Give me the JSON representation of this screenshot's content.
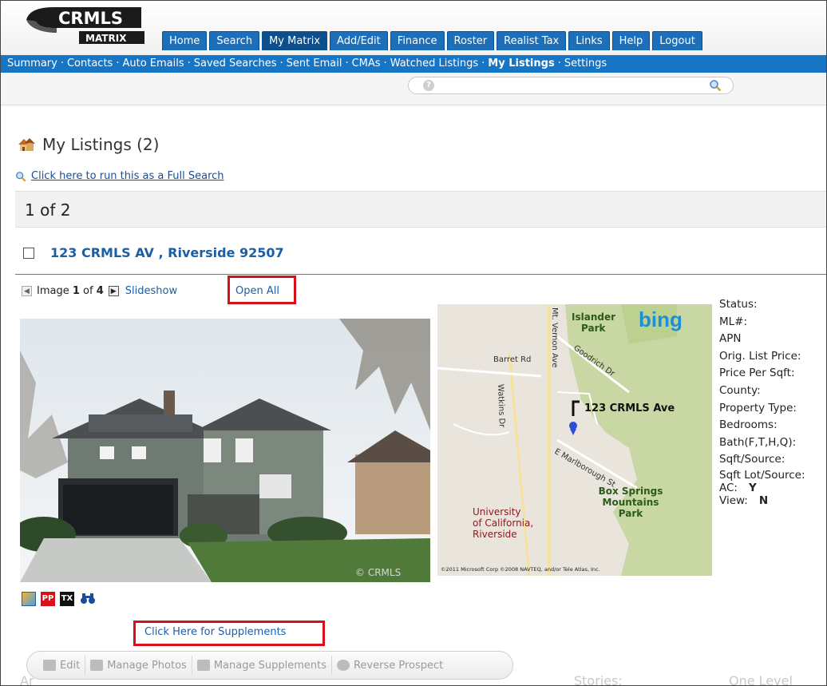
{
  "app": {
    "logo_top": "CRMLS",
    "logo_bottom": "MATRIX"
  },
  "tabs": [
    {
      "label": "Home"
    },
    {
      "label": "Search"
    },
    {
      "label": "My Matrix"
    },
    {
      "label": "Add/Edit"
    },
    {
      "label": "Finance"
    },
    {
      "label": "Roster"
    },
    {
      "label": "Realist Tax"
    },
    {
      "label": "Links"
    },
    {
      "label": "Help"
    },
    {
      "label": "Logout"
    }
  ],
  "subnav": [
    {
      "label": "Summary"
    },
    {
      "label": "Contacts"
    },
    {
      "label": "Auto Emails"
    },
    {
      "label": "Saved Searches"
    },
    {
      "label": "Sent Email"
    },
    {
      "label": "CMAs"
    },
    {
      "label": "Watched Listings"
    },
    {
      "label": "My Listings",
      "active": true
    },
    {
      "label": "Settings"
    }
  ],
  "separator": "·",
  "page": {
    "title": "My Listings (2)",
    "full_search_link": "Click here to run this as a Full Search",
    "counter": "1 of 2"
  },
  "listing": {
    "address": "123 CRMLS AV , Riverside 92507",
    "image_word": "Image",
    "image_index": "1",
    "image_of": "of",
    "image_total": "4",
    "slideshow": "Slideshow",
    "open_all": "Open All",
    "photo_watermark": "© CRMLS",
    "supplements_link": "Click Here for Supplements"
  },
  "map": {
    "brand": "bing",
    "labels": {
      "islander": "Islander",
      "park": "Park",
      "mt_vernon": "Mt. Vernon Ave",
      "barret": "Barret Rd",
      "goodrich": "Goodrich Dr",
      "watkins": "Watkins Dr",
      "pin_label": "123 CRMLS Ave",
      "marlborough": "E Marlborough St",
      "box_springs_1": "Box Springs",
      "box_springs_2": "Mountains",
      "box_springs_3": "Park",
      "uc_1": "University",
      "uc_2": "of California,",
      "uc_3": "Riverside",
      "copyright": "©2011 Microsoft Corp ©2008 NAVTEQ, and/or Tele Atlas, Inc."
    }
  },
  "props": [
    {
      "label": "Status:"
    },
    {
      "label": "ML#:"
    },
    {
      "label": "APN"
    },
    {
      "label": "Orig. List Price:"
    },
    {
      "label": "Price Per Sqft:"
    },
    {
      "label": "County:"
    },
    {
      "label": "Property Type:"
    },
    {
      "label": "Bedrooms:"
    },
    {
      "label": "Bath(F,T,H,Q):"
    },
    {
      "label": "Sqft/Source:"
    },
    {
      "label": "Sqft Lot/Source:"
    }
  ],
  "props_values": [
    {
      "label": "AC:",
      "value": "Y"
    },
    {
      "label": "View:",
      "value": "N"
    }
  ],
  "tool_icons": {
    "pp": "PP",
    "tx": "TX"
  },
  "toolbar": [
    {
      "label": "Edit"
    },
    {
      "label": "Manage Photos"
    },
    {
      "label": "Manage Supplements"
    },
    {
      "label": "Reverse Prospect"
    }
  ],
  "faded": {
    "left": "Ar",
    "stories": "Stories:",
    "stories_value": "One Level"
  }
}
